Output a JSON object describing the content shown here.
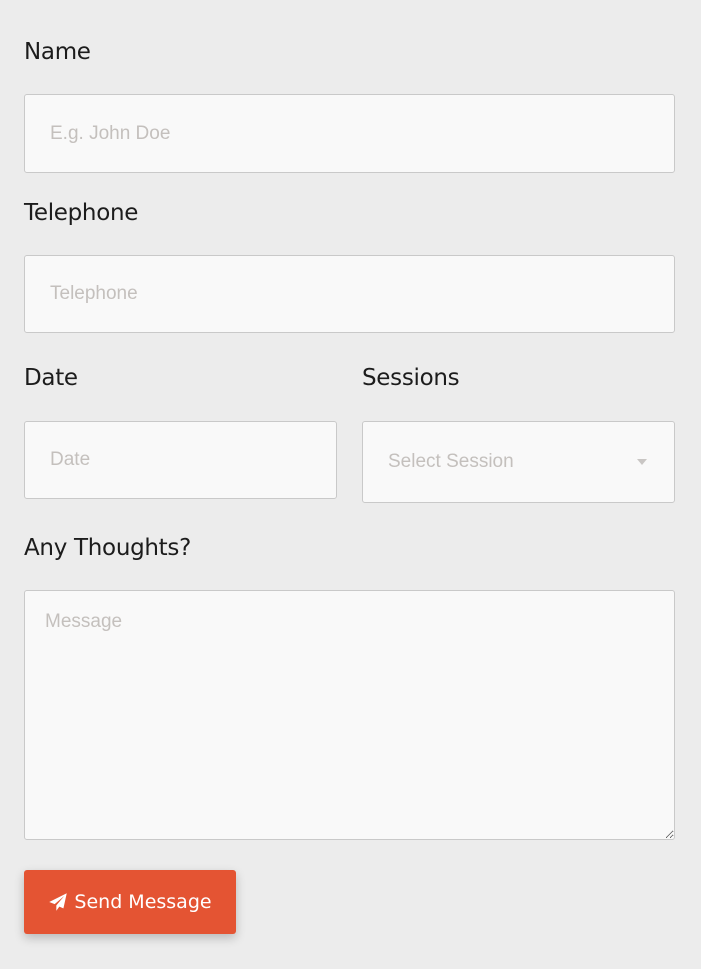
{
  "form": {
    "name": {
      "label": "Name",
      "placeholder": "E.g. John Doe",
      "value": ""
    },
    "telephone": {
      "label": "Telephone",
      "placeholder": "Telephone",
      "value": ""
    },
    "date": {
      "label": "Date",
      "placeholder": "Date",
      "value": ""
    },
    "sessions": {
      "label": "Sessions",
      "selected": "Select Session"
    },
    "thoughts": {
      "label": "Any Thoughts?",
      "placeholder": "Message",
      "value": ""
    },
    "submit": {
      "label": "Send Message",
      "icon": "paper-plane-icon"
    }
  },
  "colors": {
    "background": "#ececec",
    "field_background": "#f9f9f9",
    "field_border": "#c9c9c9",
    "placeholder": "#c4c0bd",
    "button": "#e45433",
    "button_text": "#ffffff",
    "label_text": "#1c1c1c"
  }
}
